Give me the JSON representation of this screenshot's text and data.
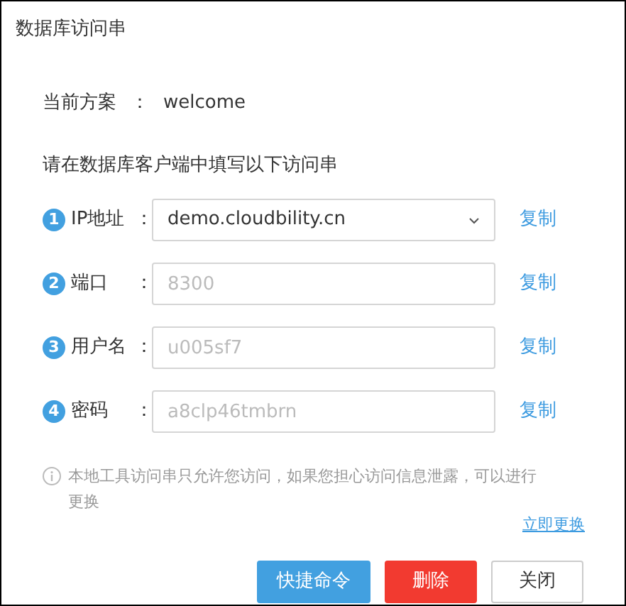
{
  "dialog": {
    "title": "数据库访问串"
  },
  "scheme": {
    "label": "当前方案",
    "colon": "：",
    "value": "welcome"
  },
  "instruction": "请在数据库客户端中填写以下访问串",
  "fields": [
    {
      "step": "1",
      "label": "IP地址",
      "colon": "：",
      "kind": "select",
      "value": "demo.cloudbility.cn",
      "disabled": false,
      "copy": "复制"
    },
    {
      "step": "2",
      "label": "端口",
      "colon": "：",
      "kind": "input",
      "value": "8300",
      "disabled": true,
      "copy": "复制"
    },
    {
      "step": "3",
      "label": "用户名",
      "colon": "：",
      "kind": "input",
      "value": "u005sf7",
      "disabled": true,
      "copy": "复制"
    },
    {
      "step": "4",
      "label": "密码",
      "colon": "：",
      "kind": "input",
      "value": "a8clp46tmbrn",
      "disabled": true,
      "copy": "复制"
    }
  ],
  "notice": {
    "text": "本地工具访问串只允许您访问，如果您担心访问信息泄露，可以进行更换",
    "link": "立即更换"
  },
  "buttons": [
    {
      "label": "快捷命令",
      "kind": "primary"
    },
    {
      "label": "删除",
      "kind": "danger"
    },
    {
      "label": "关闭",
      "kind": "default"
    }
  ]
}
